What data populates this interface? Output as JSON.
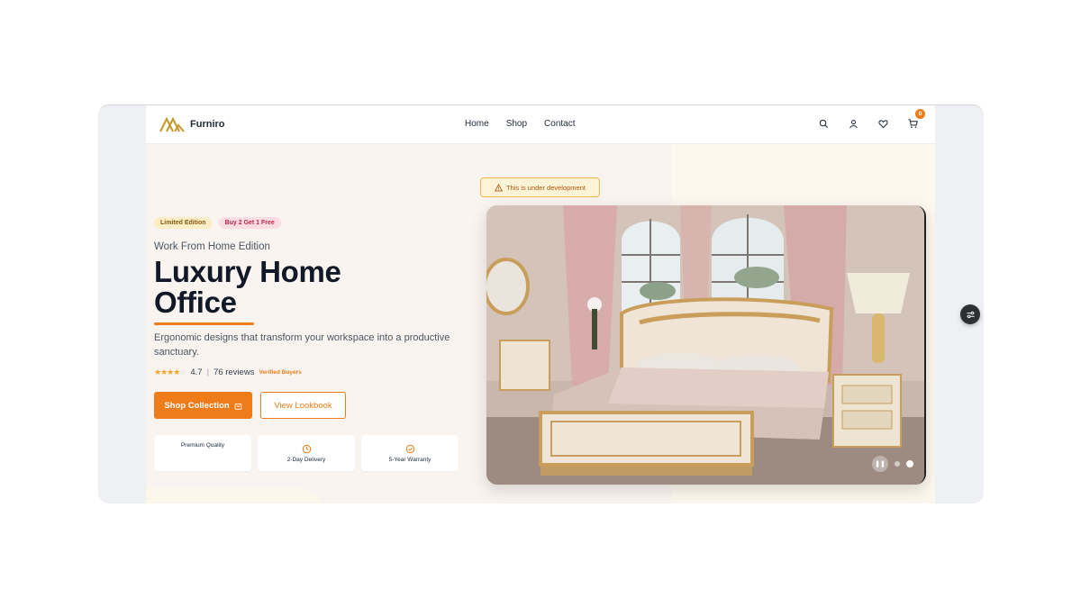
{
  "brand": {
    "name": "Furniro",
    "accent": "#ef7c1b"
  },
  "nav": {
    "items": [
      "Home",
      "Shop",
      "Contact"
    ]
  },
  "header_icons": [
    "search-icon",
    "user-icon",
    "heart-icon",
    "cart-icon"
  ],
  "cart": {
    "count": "0"
  },
  "hero": {
    "badges": {
      "limited": "Limited Edition",
      "offer": "Buy 2 Get 1 Free"
    },
    "subtitle": "Work From Home Edition",
    "title_line1": "Luxury Home",
    "title_line2": "Office",
    "description": "Ergonomic designs that transform your workspace into a productive sanctuary.",
    "rating": {
      "score": "4.7",
      "reviews": "76 reviews",
      "verified": "Verified Buyers",
      "stars": 4
    },
    "buttons": {
      "primary": "Shop Collection",
      "secondary": "View Lookbook"
    },
    "features": [
      "Premium Quality",
      "2-Day Delivery",
      "5-Year Warranty"
    ]
  },
  "dev_banner": "This is under development",
  "slider": {
    "slides": 2,
    "active": 2
  }
}
